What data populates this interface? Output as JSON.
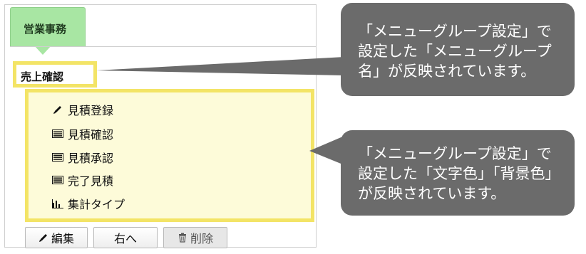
{
  "tab": {
    "label": "営業事務"
  },
  "group": {
    "name": "売上確認"
  },
  "menu": {
    "items": [
      {
        "label": "見積登録",
        "icon": "pencil-icon"
      },
      {
        "label": "見積確認",
        "icon": "list-icon"
      },
      {
        "label": "見積承認",
        "icon": "list-icon"
      },
      {
        "label": "完了見積",
        "icon": "list-icon"
      },
      {
        "label": "集計タイプ",
        "icon": "bar-chart-icon"
      }
    ],
    "highlight_color": "#f3e466",
    "background_color": "#fdfbd9"
  },
  "buttons": {
    "edit_label": "編集",
    "right_label": "右へ",
    "delete_label": "削除"
  },
  "callouts": {
    "top": {
      "lines": [
        "「メニューグループ設定」で",
        "設定した「メニューグループ",
        "名」が反映されています。"
      ]
    },
    "bottom": {
      "lines": [
        "「メニューグループ設定」で",
        "設定した「文字色」「背景色」",
        "が反映されています。"
      ]
    },
    "color": "#6b6b6b"
  },
  "colors": {
    "tab": "#a8e6a3"
  }
}
